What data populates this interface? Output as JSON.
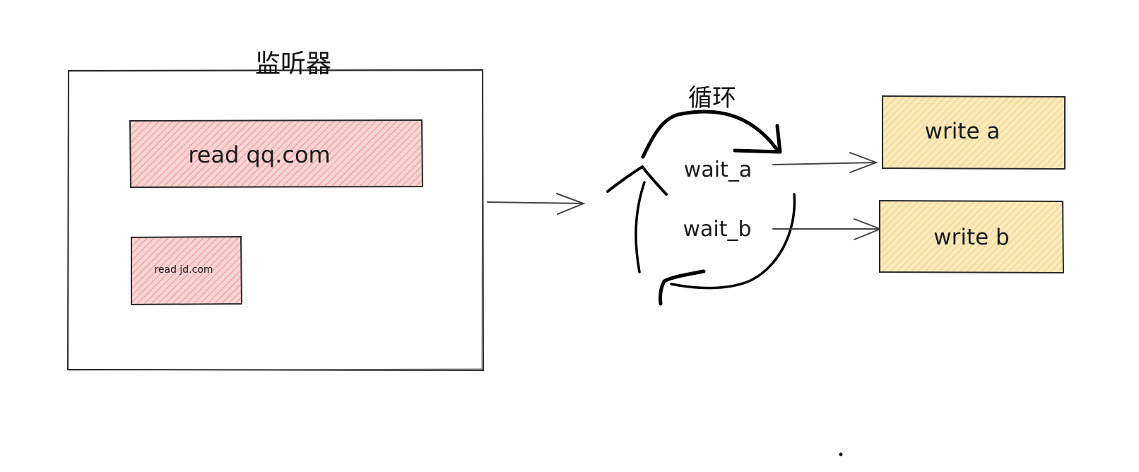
{
  "listener": {
    "title": "监听器",
    "read_qq": "read qq.com",
    "read_jd": "read jd.com"
  },
  "loop": {
    "title": "循环",
    "wait_a": "wait_a",
    "wait_b": "wait_b"
  },
  "writers": {
    "write_a": "write a",
    "write_b": "write b"
  },
  "colors": {
    "red_fill": "#f4c7c7",
    "red_hatch": "#e87a7a",
    "yellow_fill": "#f9e4ad",
    "yellow_hatch": "#efc463",
    "stroke": "#1e1e1e"
  }
}
